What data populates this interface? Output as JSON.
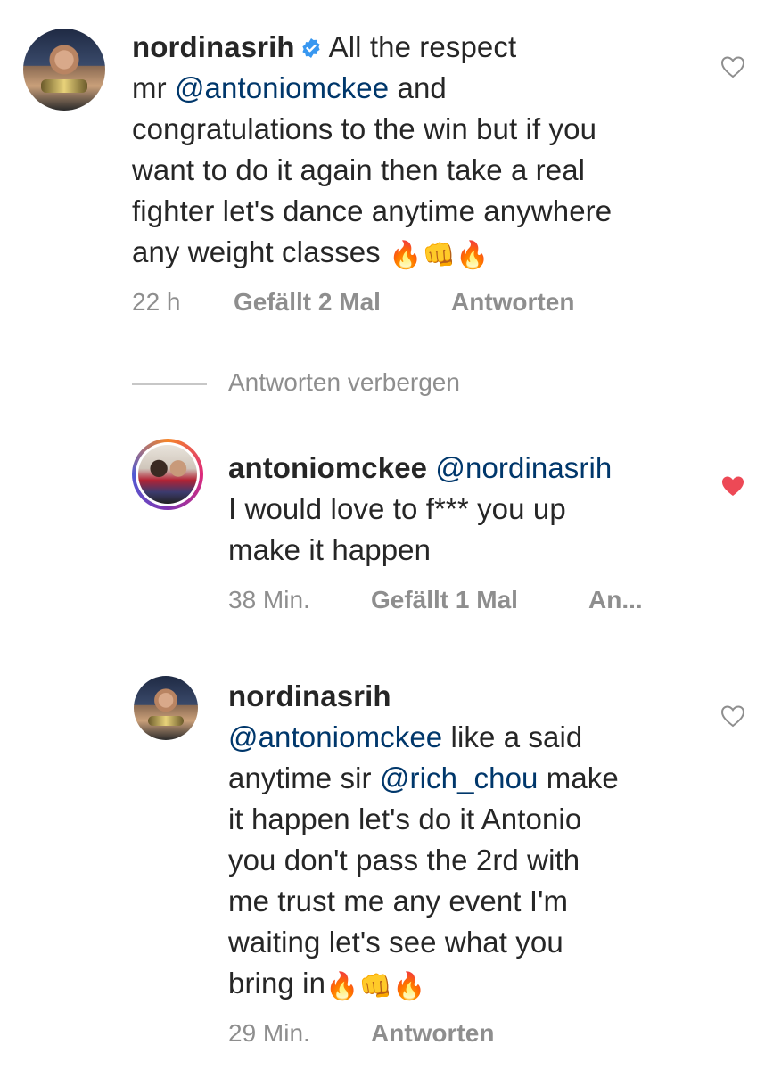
{
  "comments": [
    {
      "username": "nordinasrih",
      "verified": true,
      "text_parts": [
        "All the respect",
        "mr ",
        "@antoniomckee",
        " and",
        "congratulations to the win but if you",
        "want to do it again then take a real",
        "fighter let's dance anytime anywhere",
        "any weight classes "
      ],
      "emojis": "🔥👊🔥",
      "time": "22 h",
      "likes": "Gefällt 2 Mal",
      "reply": "Antworten",
      "liked": false
    },
    {
      "username": "antoniomckee",
      "mention": "@nordinasrih",
      "lines": [
        "I would love to f*** you up",
        "make it happen"
      ],
      "time": "38 Min.",
      "likes": "Gefällt 1 Mal",
      "reply": "An...",
      "liked": true
    },
    {
      "username": "nordinasrih",
      "mention1": "@antoniomckee",
      "line1_rest": " like a said",
      "line2_pre": "anytime sir ",
      "mention2": "@rich_chou",
      "line2_rest": " make",
      "lines": [
        "it happen let's do it Antonio",
        "you don't pass the 2rd with",
        "me  trust me any event I'm",
        "waiting let's see what you"
      ],
      "last_line": "bring in",
      "emojis": "🔥👊🔥",
      "time": "29 Min.",
      "reply": "Antworten",
      "liked": false
    }
  ],
  "hide_replies_label": "Antworten verbergen",
  "colors": {
    "mention": "#00376b",
    "heart_liked": "#ed4956",
    "meta": "#8e8e8e",
    "verified": "#3897f0"
  },
  "icons": {
    "like": "heart-icon",
    "verified": "verified-badge-icon"
  }
}
